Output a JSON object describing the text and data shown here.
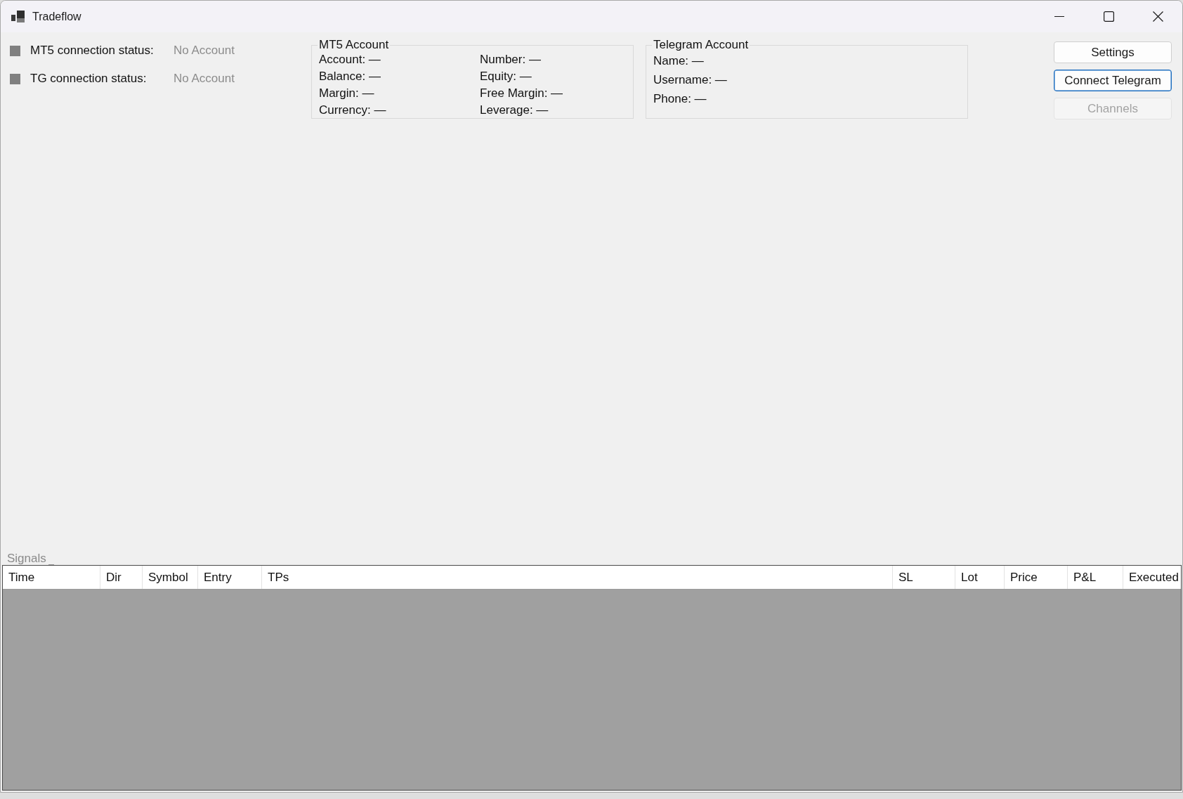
{
  "window": {
    "title": "Tradeflow"
  },
  "connection_status": [
    {
      "label": "MT5 connection status:",
      "value": "No Account",
      "color": "#808080"
    },
    {
      "label": "TG connection status:",
      "value": "No Account",
      "color": "#808080"
    }
  ],
  "mt5_account": {
    "title": "MT5 Account",
    "columns": [
      [
        "Account: —",
        "Balance: —",
        "Margin: —",
        "Currency: —"
      ],
      [
        "Number: —",
        "Equity: —",
        "Free Margin: —",
        "Leverage: —"
      ]
    ]
  },
  "telegram_account": {
    "title": "Telegram Account",
    "fields": [
      "Name: —",
      "Username: —",
      "Phone: —"
    ]
  },
  "buttons": [
    {
      "label": "Settings",
      "disabled": false,
      "focused": false
    },
    {
      "label": "Connect Telegram",
      "disabled": false,
      "focused": true
    },
    {
      "label": "Channels",
      "disabled": true,
      "focused": false
    }
  ],
  "signals": {
    "title": "Signals",
    "table": {
      "columns": [
        "Time",
        "Dir",
        "Symbol",
        "Entry",
        "TPs",
        "SL",
        "Lot",
        "Price",
        "P&L",
        "Executed"
      ]
    }
  }
}
